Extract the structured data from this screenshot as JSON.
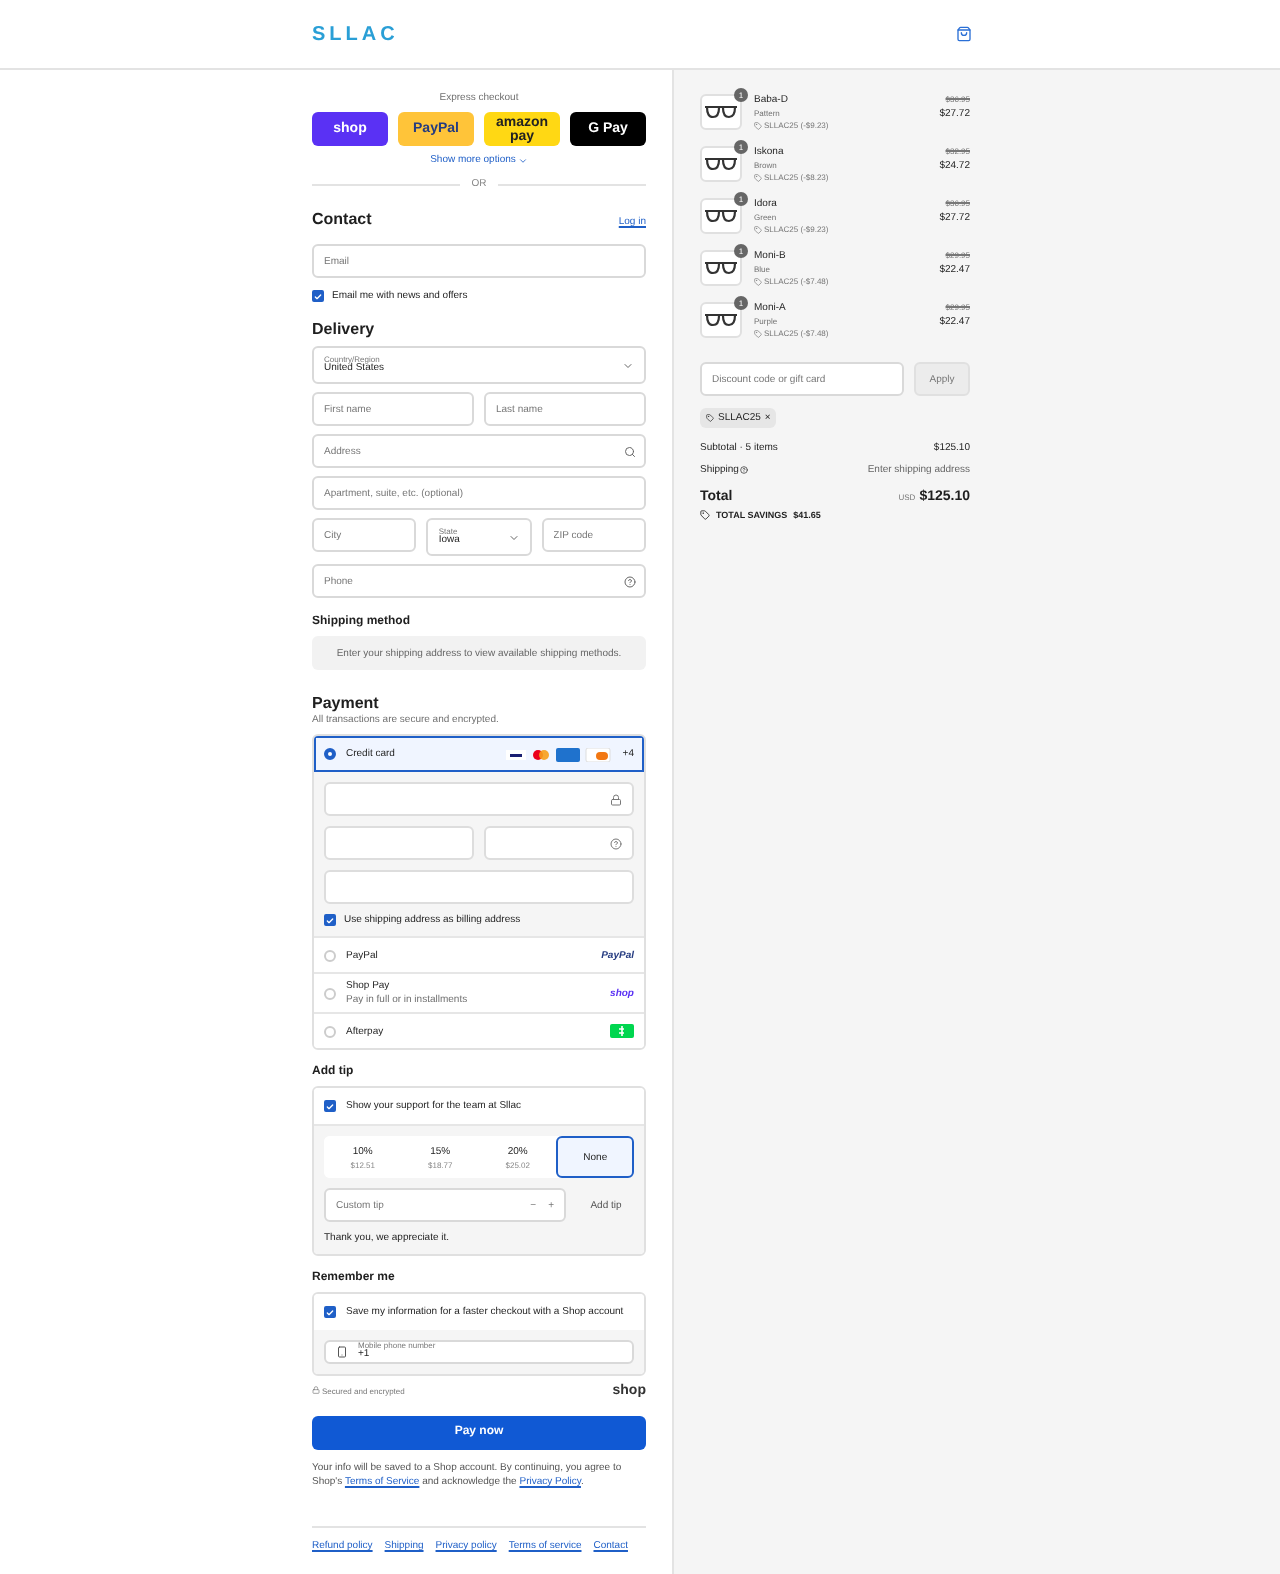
{
  "header": {
    "logo": "SLLAC"
  },
  "express": {
    "label": "Express checkout",
    "buttons": [
      {
        "kind": "shop",
        "label": "shop"
      },
      {
        "kind": "paypal",
        "label": "PayPal"
      },
      {
        "kind": "amazon",
        "label": "amazon pay"
      },
      {
        "kind": "gpay",
        "label": "G Pay"
      }
    ],
    "more": "Show more options",
    "divider": "OR"
  },
  "contact": {
    "title": "Contact",
    "login": "Log in",
    "email": {
      "placeholder": "Email"
    },
    "news": {
      "label": "Email me with news and offers",
      "checked": true
    }
  },
  "delivery": {
    "title": "Delivery",
    "rows": [
      [
        {
          "kind": "select",
          "label": "Country/Region",
          "value": "United States"
        }
      ],
      [
        {
          "kind": "text",
          "placeholder": "First name"
        },
        {
          "kind": "text",
          "placeholder": "Last name"
        }
      ],
      [
        {
          "kind": "search",
          "placeholder": "Address"
        }
      ],
      [
        {
          "kind": "text",
          "placeholder": "Apartment, suite, etc. (optional)"
        }
      ],
      [
        {
          "kind": "text",
          "placeholder": "City"
        },
        {
          "kind": "select",
          "label": "State",
          "value": "Iowa"
        },
        {
          "kind": "text",
          "placeholder": "ZIP code"
        }
      ],
      [
        {
          "kind": "help",
          "placeholder": "Phone"
        }
      ]
    ]
  },
  "shipping": {
    "title": "Shipping method",
    "note": "Enter your shipping address to view available shipping methods."
  },
  "payment": {
    "title": "Payment",
    "subtitle": "All transactions are secure and encrypted.",
    "methods": [
      {
        "kind": "card",
        "label": "Credit card",
        "selected": true,
        "more": "+4",
        "billing": {
          "label": "Use shipping address as billing address",
          "checked": true
        }
      },
      {
        "kind": "paypal",
        "label": "PayPal",
        "logo": "PayPal",
        "selected": false
      },
      {
        "kind": "shop",
        "label": "Shop Pay",
        "note": "Pay in full or in installments",
        "logo": "shop",
        "selected": false
      },
      {
        "kind": "afterpay",
        "label": "Afterpay",
        "selected": false
      }
    ]
  },
  "tip": {
    "title": "Add tip",
    "support": {
      "label": "Show your support for the team at Sllac",
      "checked": true
    },
    "options": [
      {
        "percent": "10%",
        "amount": "$12.51",
        "selected": false
      },
      {
        "percent": "15%",
        "amount": "$18.77",
        "selected": false
      },
      {
        "percent": "20%",
        "amount": "$25.02",
        "selected": false
      },
      {
        "percent": "None",
        "selected": true
      }
    ],
    "custom": {
      "placeholder": "Custom tip"
    },
    "minus": "−",
    "plus": "+",
    "add": "Add tip",
    "thanks": "Thank you, we appreciate it."
  },
  "remember": {
    "title": "Remember me",
    "save": {
      "label": "Save my information for a faster checkout with a Shop account",
      "checked": true
    },
    "phone": {
      "label": "Mobile phone number",
      "value": "+1"
    },
    "secured": "Secured and encrypted",
    "brand": "shop"
  },
  "pay": "Pay now",
  "legal": {
    "before": "Your info will be saved to a Shop account. By continuing, you agree to Shop's",
    "terms": "Terms of Service",
    "middle": "and acknowledge the",
    "privacy": "Privacy Policy",
    "after": "."
  },
  "footer": [
    "Refund policy",
    "Shipping",
    "Privacy policy",
    "Terms of service",
    "Contact"
  ],
  "summary": {
    "items": [
      {
        "name": "Baba-D",
        "variant": "Pattern",
        "quantity": "1",
        "discount": "SLLAC25 (-$9.23)",
        "original": "$36.95",
        "price": "$27.72"
      },
      {
        "name": "Iskona",
        "variant": "Brown",
        "quantity": "1",
        "discount": "SLLAC25 (-$8.23)",
        "original": "$32.95",
        "price": "$24.72"
      },
      {
        "name": "Idora",
        "variant": "Green",
        "quantity": "1",
        "discount": "SLLAC25 (-$9.23)",
        "original": "$36.95",
        "price": "$27.72"
      },
      {
        "name": "Moni-B",
        "variant": "Blue",
        "quantity": "1",
        "discount": "SLLAC25 (-$7.48)",
        "original": "$29.95",
        "price": "$22.47"
      },
      {
        "name": "Moni-A",
        "variant": "Purple",
        "quantity": "1",
        "discount": "SLLAC25 (-$7.48)",
        "original": "$29.95",
        "price": "$22.47"
      }
    ],
    "discount": {
      "placeholder": "Discount code or gift card",
      "apply": "Apply"
    },
    "code": {
      "label": "SLLAC25",
      "remove": "×"
    },
    "subtotal": {
      "label": "Subtotal · 5 items",
      "value": "$125.10"
    },
    "shipping": {
      "label": "Shipping",
      "value": "Enter shipping address"
    },
    "total": {
      "label": "Total",
      "currency": "USD",
      "value": "$125.10"
    },
    "savings": {
      "label": "TOTAL SAVINGS",
      "value": "$41.65"
    }
  }
}
